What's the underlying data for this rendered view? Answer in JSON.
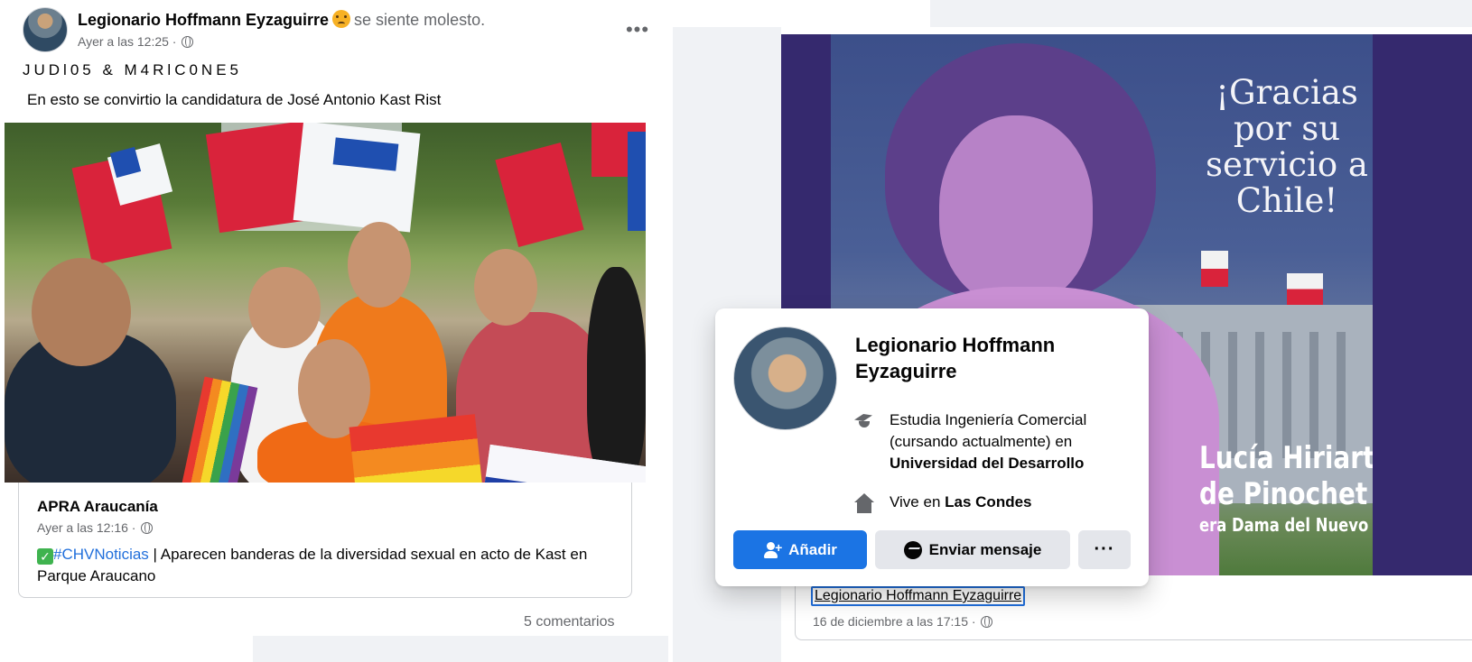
{
  "left_post": {
    "author": "Legionario Hoffmann Eyzaguirre",
    "feeling": "se siente molesto.",
    "timestamp": "Ayer a las 12:25 ·",
    "line1": "JUDl05 & M4RlC0NE5",
    "line2": "En esto se convirtio la candidatura de José Antonio Kast Rist",
    "link_preview": {
      "source": "APRA Araucanía",
      "timestamp": "Ayer a las 12:16 ·",
      "hashtag": "#CHVNoticias",
      "text": " | Aparecen banderas de la diversidad sexual en acto de Kast en Parque Araucano"
    },
    "comments": "5 comentarios"
  },
  "right_post": {
    "poster": {
      "title": "¡Gracias por su servicio a Chile!",
      "name_line1": "Lucía Hiriart R.",
      "name_line2": "de Pinochet",
      "subtitle": "era Dama del Nuevo Chile"
    },
    "shared_author": "Legionario Hoffmann Eyzaguirre",
    "shared_timestamp": "16 de diciembre a las 17:15 ·"
  },
  "hover_card": {
    "name": "Legionario Hoffmann Eyzaguirre",
    "study_prefix": "Estudia Ingeniería Comercial (cursando actualmente) en",
    "study_school": "Universidad del Desarrollo",
    "lives_prefix": "Vive en",
    "lives_place": "Las Condes",
    "add_button": "Añadir",
    "message_button": "Enviar mensaje",
    "more_button": "···"
  },
  "colors": {
    "accent": "#1b74e4",
    "link": "#216fdb",
    "secondary_text": "#65676b",
    "poster_background": "#35296e"
  },
  "icons": [
    "globe-icon",
    "more-icon",
    "check-icon",
    "graduation-cap-icon",
    "home-icon",
    "add-user-icon",
    "messenger-icon"
  ]
}
